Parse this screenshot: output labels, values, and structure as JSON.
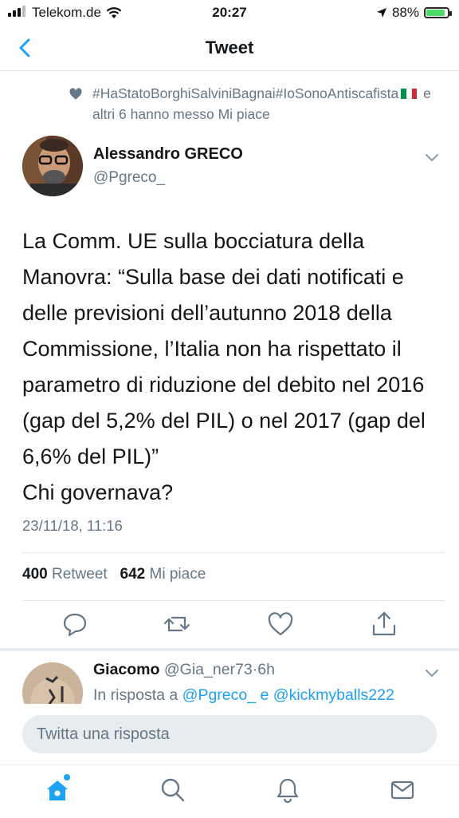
{
  "status": {
    "carrier": "Telekom.de",
    "time": "20:27",
    "battery": "88%",
    "battery_level": 0.88
  },
  "header": {
    "title": "Tweet"
  },
  "social_context": {
    "text_before_flag": "#HaStatoBorghiSalviniBagnai#IoSonoAntiscafista",
    "text_after_flag": "e altri 6 hanno messo Mi piace"
  },
  "tweet": {
    "author_name": "Alessandro GRECO",
    "author_handle": "@Pgreco_",
    "text": "La Comm. UE sulla bocciatura della Manovra: “Sulla base dei dati notificati e delle previsioni dell’autunno 2018 della Commissione, l’Italia non ha rispettato il parametro di riduzione del debito nel 2016 (gap del 5,2% del PIL) o nel 2017 (gap del 6,6% del PIL)”\nChi governava?",
    "timestamp": "23/11/18, 11:16",
    "retweet_count": "400",
    "retweet_label": "Retweet",
    "like_count": "642",
    "like_label": "Mi piace"
  },
  "reply": {
    "name": "Giacomo",
    "handle": "@Gia_ner73",
    "separator": "·",
    "time": "6h",
    "in_reply_prefix": "In risposta a",
    "mention_1": "@Pgreco_",
    "conjunction": "e",
    "mention_2": "@kickmyballs222"
  },
  "composer": {
    "placeholder": "Twitta una risposta"
  },
  "colors": {
    "accent": "#1da1f2",
    "secondary_text": "#657786",
    "divider": "#e1e8ed"
  },
  "icons": {
    "nav_back": "chevron-left-icon",
    "social_context": "heart-icon",
    "actions": [
      "reply-icon",
      "retweet-icon",
      "like-icon",
      "share-icon"
    ],
    "tabs": [
      "home-icon",
      "search-icon",
      "notifications-icon",
      "messages-icon"
    ]
  }
}
